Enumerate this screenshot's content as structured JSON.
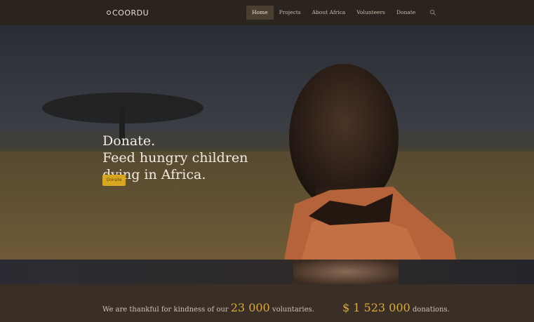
{
  "nav": {
    "logo": "COORDU",
    "items": [
      {
        "label": "Home",
        "active": true
      },
      {
        "label": "Projects",
        "active": false
      },
      {
        "label": "About Africa",
        "active": false
      },
      {
        "label": "Volunteers",
        "active": false
      },
      {
        "label": "Donate",
        "active": false
      }
    ],
    "search_icon": "search-icon"
  },
  "hero": {
    "line1": "Donate.",
    "line2": "Feed hungry children",
    "line3": "dying in Africa.",
    "button_label": "Donate"
  },
  "stats": {
    "left_prefix": "We are thankful for kindness of our",
    "left_number": "23 000",
    "left_suffix": "voluntaries.",
    "right_number": "$ 1 523 000",
    "right_suffix": "donations."
  },
  "colors": {
    "accent": "#d6a71f",
    "nav_bg": "#2b231d",
    "stats_bg": "#3a2f26"
  }
}
